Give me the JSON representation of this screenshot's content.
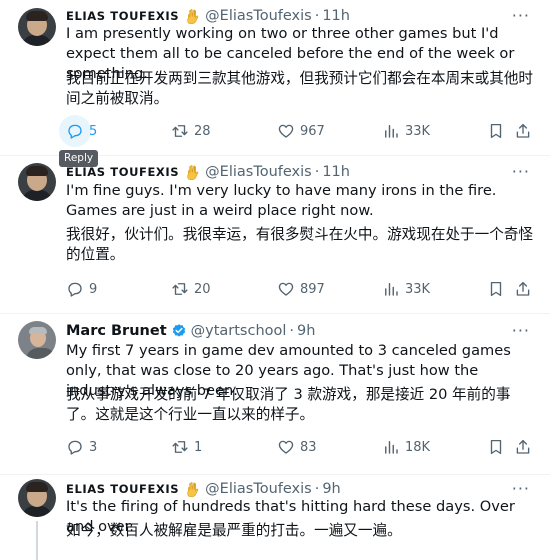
{
  "tweets": [
    {
      "name": "ELIAS TOUFEXIS",
      "handle": "@EliasToufexis",
      "time": "11h",
      "text_en": "I am presently working on two or three other games but I'd expect them all to be canceled before the end of the week or something.",
      "text_zh": "我目前正在开发两到三款其他游戏，但我预计它们都会在本周末或其他时间之前被取消。",
      "replies": "5",
      "retweets": "28",
      "likes": "967",
      "views": "33K"
    },
    {
      "name": "ELIAS TOUFEXIS",
      "handle": "@EliasToufexis",
      "time": "11h",
      "text_en": "I'm fine guys. I'm very lucky to have many irons in the fire. Games are just in a weird place right now.",
      "text_zh": "我很好，伙计们。我很幸运，有很多熨斗在火中。游戏现在处于一个奇怪的位置。",
      "replies": "9",
      "retweets": "20",
      "likes": "897",
      "views": "33K"
    },
    {
      "name": "Marc Brunet",
      "handle": "@ytartschool",
      "time": "9h",
      "text_en": "My first 7 years in game dev amounted to 3 canceled games only, that was close to 20 years ago. That's just how the industry's always been.",
      "text_zh": "我从事游戏开发的前 7 年仅取消了 3 款游戏，那是接近 20 年前的事了。这就是这个行业一直以来的样子。",
      "replies": "3",
      "retweets": "1",
      "likes": "83",
      "views": "18K"
    },
    {
      "name": "ELIAS TOUFEXIS",
      "handle": "@EliasToufexis",
      "time": "9h",
      "text_en": "It's the firing of hundreds that's hitting hard these days. Over and over.",
      "text_zh": "如今，数百人被解雇是最严重的打击。一遍又一遍。"
    }
  ],
  "tooltip": "Reply",
  "more_glyph": "···",
  "dot": "·",
  "icons": [
    "reply-icon",
    "retweet-icon",
    "like-icon",
    "views-icon",
    "bookmark-icon",
    "share-icon",
    "verified-badge-icon",
    "vulcan-salute-emoji"
  ],
  "colors": {
    "accent": "#1d9bf0",
    "muted": "#536471",
    "verified": "#1d9bf0",
    "hover_bg": "#e8f5fd",
    "tooltip_bg": "#555b61"
  }
}
